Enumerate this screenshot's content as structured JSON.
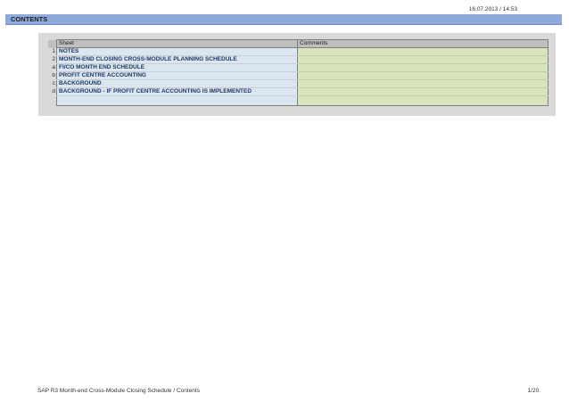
{
  "header": {
    "timestamp": "16.07.2013 / 14:53"
  },
  "title": "CONTENTS",
  "table": {
    "headers": {
      "sheet": "Sheet",
      "comments": "Comments"
    },
    "rows": [
      {
        "index": "1",
        "sheet": "NOTES",
        "comment": ""
      },
      {
        "index": "2",
        "sheet": "MONTH-END CLOSING CROSS-MODULE PLANNING SCHEDULE",
        "comment": ""
      },
      {
        "index": "a",
        "sheet": "FI/CO MONTH END SCHEDULE",
        "comment": ""
      },
      {
        "index": "b",
        "sheet": "PROFIT CENTRE ACCOUNTING",
        "comment": ""
      },
      {
        "index": "c",
        "sheet": "BACKGROUND",
        "comment": ""
      },
      {
        "index": "d",
        "sheet": "BACKGROUND - IF PROFIT CENTRE ACCOUNTING IS IMPLEMENTED",
        "comment": ""
      }
    ]
  },
  "footer": {
    "left": "SAP R3 Month-end Cross-Module Closing Schedule / Contents",
    "right": "1/20."
  }
}
